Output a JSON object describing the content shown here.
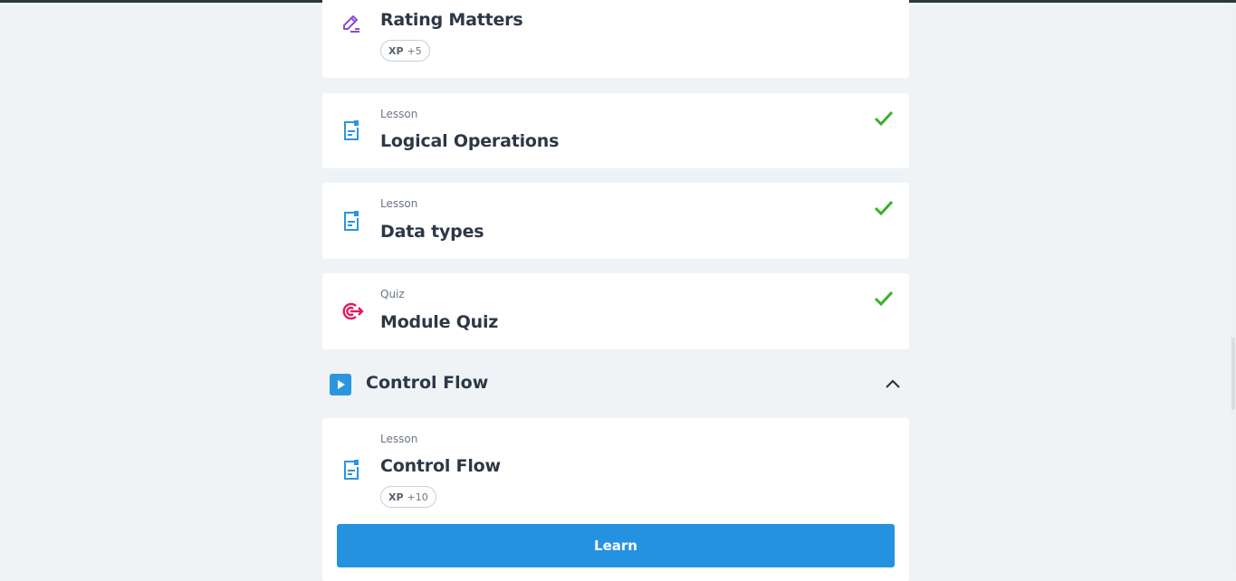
{
  "items": [
    {
      "kind": "",
      "title": "Rating Matters",
      "xp_label": "XP",
      "xp_value": "+5",
      "completed": false,
      "icon": "edit-pen-icon"
    },
    {
      "kind": "Lesson",
      "title": "Logical Operations",
      "completed": true,
      "icon": "lesson-doc-icon"
    },
    {
      "kind": "Lesson",
      "title": "Data types",
      "completed": true,
      "icon": "lesson-doc-icon"
    },
    {
      "kind": "Quiz",
      "title": "Module Quiz",
      "completed": true,
      "icon": "quiz-target-icon"
    }
  ],
  "section": {
    "title": "Control Flow",
    "icon": "play-icon",
    "toggle_icon": "chevron-up-icon",
    "lesson": {
      "kind": "Lesson",
      "title": "Control Flow",
      "xp_label": "XP",
      "xp_value": "+10",
      "icon": "lesson-doc-icon"
    },
    "cta_label": "Learn"
  },
  "colors": {
    "page_bg": "#eff3f6",
    "accent_blue": "#2492e0",
    "check_green": "#38b02a",
    "quiz_pink": "#e6195a",
    "edit_purple": "#8a4bd6"
  }
}
